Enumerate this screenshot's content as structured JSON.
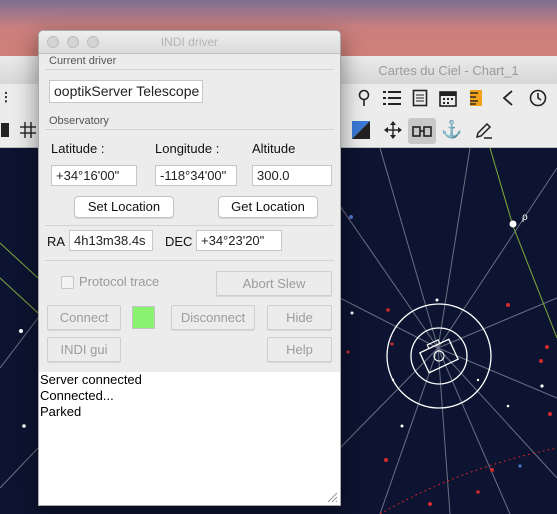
{
  "background_app": {
    "title": "Cartes du Ciel - Chart_1",
    "toolbar_row1_icons": [
      "pin-icon",
      "list-icon",
      "notebook-icon",
      "calendar-icon",
      "ruler-icon",
      "back-arrow-icon",
      "clock-icon"
    ],
    "toolbar_row2_icons": [
      "blue-square-icon",
      "move-icon",
      "binoculars-icon",
      "anchor-icon",
      "edit-icon"
    ],
    "sky_label": "ρ"
  },
  "window": {
    "title": "INDI driver"
  },
  "current_driver": {
    "section_label": "Current driver",
    "value": "ooptikServer Telescope"
  },
  "observatory": {
    "section_label": "Observatory",
    "latitude_label": "Latitude :",
    "longitude_label": "Longitude :",
    "altitude_label": "Altitude",
    "latitude": "+34°16'00\"",
    "longitude": "-118°34'00\"",
    "altitude": "300.0",
    "set_location": "Set Location",
    "get_location": "Get Location"
  },
  "position": {
    "ra_label": "RA",
    "ra": "4h13m38.4s",
    "dec_label": "DEC",
    "dec": "+34°23'20\""
  },
  "controls": {
    "protocol_trace": "Protocol trace",
    "abort_slew": "Abort Slew",
    "connect": "Connect",
    "disconnect": "Disconnect",
    "hide": "Hide",
    "indi_gui": "INDI gui",
    "help": "Help",
    "status_color": "#8af36f"
  },
  "log": [
    "Server connected",
    "Connected...",
    "Parked"
  ]
}
